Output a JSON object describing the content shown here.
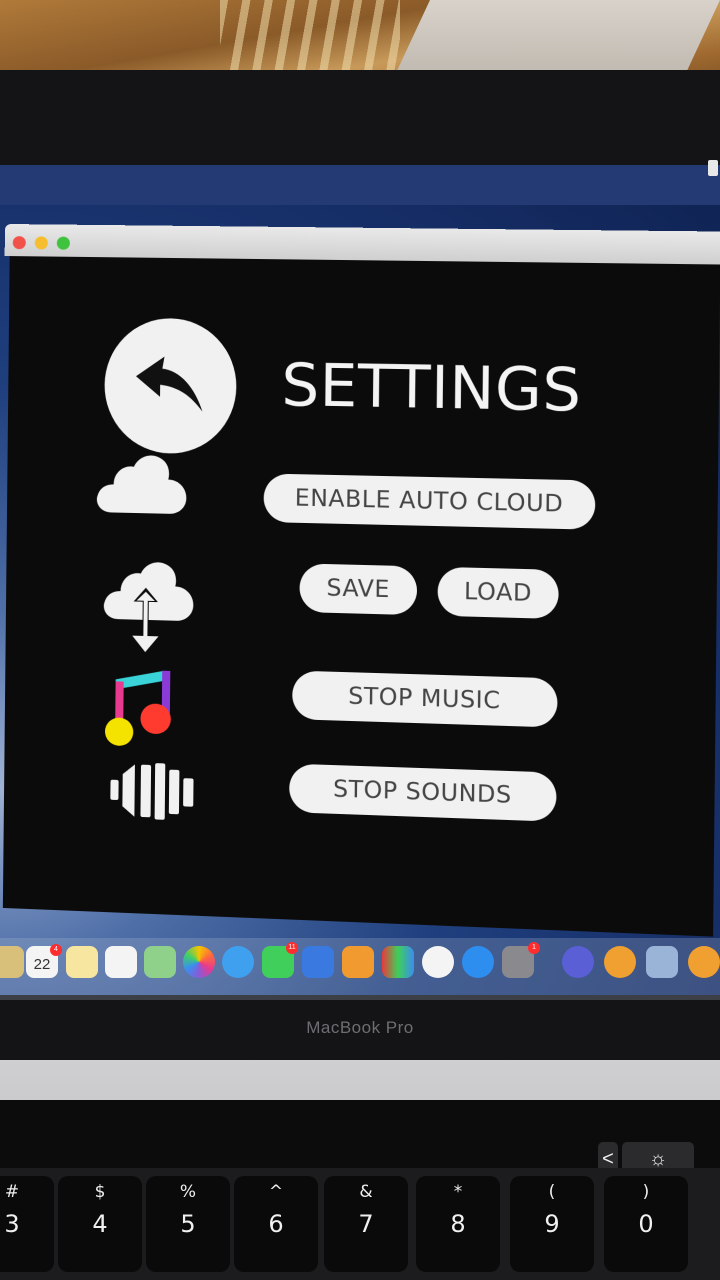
{
  "window": {
    "title": "SETTINGS",
    "buttons": {
      "enable_auto_cloud": "ENABLE AUTO CLOUD",
      "save": "SAVE",
      "load": "LOAD",
      "stop_music": "STOP MUSIC",
      "stop_sounds": "STOP SOUNDS"
    },
    "icons": [
      "back-arrow-icon",
      "cloud-icon",
      "cloud-sync-icon",
      "music-note-icon",
      "sound-bars-icon"
    ]
  },
  "dock": {
    "calendar_date": "22",
    "badges": {
      "calendar": "4",
      "facetime": "11",
      "system_prefs": "1"
    }
  },
  "laptop_label": "MacBook Pro",
  "keyboard": {
    "keys": [
      {
        "sym": "#",
        "num": "3"
      },
      {
        "sym": "$",
        "num": "4"
      },
      {
        "sym": "%",
        "num": "5"
      },
      {
        "sym": "^",
        "num": "6"
      },
      {
        "sym": "&",
        "num": "7"
      },
      {
        "sym": "*",
        "num": "8"
      },
      {
        "sym": "(",
        "num": "9"
      },
      {
        "sym": ")",
        "num": "0"
      }
    ],
    "touchbar": [
      "<",
      "☼"
    ]
  }
}
